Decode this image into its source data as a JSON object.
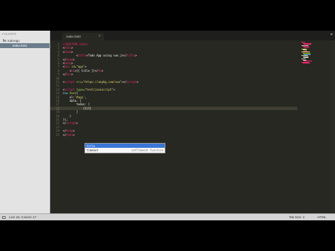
{
  "sidebar": {
    "header": "FOLDERS",
    "folder": "todoApp",
    "file": "index.html"
  },
  "tab": {
    "label": "index.html",
    "close_glyph": "×"
  },
  "code": {
    "line_numbers": [
      "1",
      "2",
      "3",
      "4",
      "5",
      "6",
      "7",
      "8",
      "9",
      "10",
      "11",
      "12",
      "13",
      "14",
      "15",
      "16",
      "17",
      "18",
      "19",
      "20",
      "21",
      "22",
      "23",
      "24",
      "25"
    ],
    "lines": [
      [
        [
          "tag",
          "<!DOCTYPE html>"
        ]
      ],
      [
        [
          "punct",
          "<"
        ],
        [
          "tag",
          "html"
        ],
        [
          "punct",
          ">"
        ]
      ],
      [
        [
          "punct",
          "<"
        ],
        [
          "tag",
          "head"
        ],
        [
          "punct",
          ">"
        ]
      ],
      [
        [
          "text",
          "        "
        ],
        [
          "punct",
          "<"
        ],
        [
          "tag",
          "title"
        ],
        [
          "punct",
          ">"
        ],
        [
          "text",
          "Todo App using vue.js"
        ],
        [
          "punct",
          "</"
        ],
        [
          "tag",
          "title"
        ],
        [
          "punct",
          ">"
        ]
      ],
      [
        [
          "punct",
          "</"
        ],
        [
          "tag",
          "head"
        ],
        [
          "punct",
          ">"
        ]
      ],
      [
        [
          "punct",
          "<"
        ],
        [
          "tag",
          "body"
        ],
        [
          "punct",
          ">"
        ]
      ],
      [
        [
          "punct",
          "<"
        ],
        [
          "tag",
          "div"
        ],
        [
          "text",
          " "
        ],
        [
          "attr",
          "id"
        ],
        [
          "punct",
          "="
        ],
        [
          "str",
          "\"app\""
        ],
        [
          "punct",
          ">"
        ]
      ],
      [
        [
          "text",
          "    "
        ],
        [
          "punct",
          "<"
        ],
        [
          "tag",
          "h1"
        ],
        [
          "punct",
          ">"
        ],
        [
          "text",
          "{{ title }}"
        ],
        [
          "punct",
          "</"
        ],
        [
          "tag",
          "h1"
        ],
        [
          "punct",
          ">"
        ]
      ],
      [
        [
          "punct",
          "</"
        ],
        [
          "tag",
          "div"
        ],
        [
          "punct",
          ">"
        ]
      ],
      [],
      [
        [
          "punct",
          "<"
        ],
        [
          "tag",
          "script"
        ],
        [
          "text",
          " "
        ],
        [
          "attr",
          "src"
        ],
        [
          "punct",
          "="
        ],
        [
          "str",
          "\"https://unpkg.com/vue\""
        ],
        [
          "punct",
          "></"
        ],
        [
          "tag",
          "script"
        ],
        [
          "punct",
          ">"
        ]
      ],
      [],
      [
        [
          "punct",
          "<"
        ],
        [
          "tag",
          "script"
        ],
        [
          "text",
          " "
        ],
        [
          "attr",
          "type"
        ],
        [
          "punct",
          "="
        ],
        [
          "str",
          "\"text/javascript\""
        ],
        [
          "punct",
          ">"
        ]
      ],
      [
        [
          "kw",
          "new"
        ],
        [
          "text",
          " "
        ],
        [
          "attr",
          "Vue"
        ],
        [
          "text",
          "({"
        ]
      ],
      [
        [
          "text",
          "    el:"
        ],
        [
          "str",
          "'#app'"
        ],
        [
          "text",
          ","
        ]
      ],
      [
        [
          "text",
          "    data: {"
        ]
      ],
      [
        [
          "text",
          "        todos: ["
        ]
      ],
      [
        [
          "text",
          "            {tit}"
        ]
      ],
      [
        [
          "text",
          "        ]"
        ]
      ],
      [
        [
          "text",
          "    }"
        ]
      ],
      [
        [
          "text",
          "});"
        ]
      ],
      [
        [
          "punct",
          "</"
        ],
        [
          "tag",
          "script"
        ],
        [
          "punct",
          ">"
        ]
      ],
      [],
      [
        [
          "punct",
          "</"
        ],
        [
          "tag",
          "body"
        ],
        [
          "punct",
          ">"
        ]
      ],
      [
        [
          "punct",
          "</"
        ],
        [
          "tag",
          "html"
        ],
        [
          "punct",
          ">"
        ]
      ]
    ]
  },
  "autocomplete": {
    "items": [
      {
        "trigger": "title",
        "description": ""
      },
      {
        "trigger": "timeout",
        "description": "setTimeout function"
      }
    ]
  },
  "minimap": {
    "line_colors": [
      "#f92672",
      "#f92672",
      "#f92672",
      "#cfcfc2",
      "#f92672",
      "#f92672",
      "#a6e22e",
      "#cfcfc2",
      "#f92672",
      "#e6db74",
      "#a6e22e",
      "#66d9ef",
      "#cfcfc2",
      "#cfcfc2",
      "#cfcfc2",
      "#cfcfc2",
      "#cfcfc2",
      "#f92672",
      "#f92672",
      "#f92672"
    ]
  },
  "statusbar": {
    "position": "Line 18, Column 17",
    "tab_size": "Tab Size: 4",
    "syntax": "HTML"
  }
}
